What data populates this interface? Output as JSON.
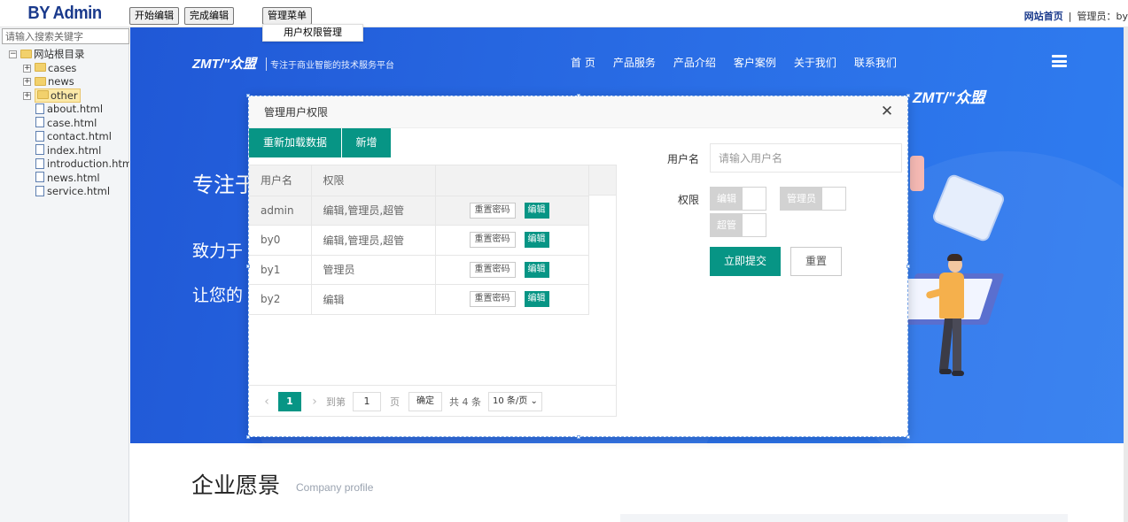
{
  "admin": {
    "brand": "BY Admin",
    "btn_start_edit": "开始编辑",
    "btn_finish_edit": "完成编辑",
    "btn_manage_menu": "管理菜单",
    "menu_item_permissions": "用户权限管理",
    "link_home": "网站首页",
    "separator": "|",
    "admin_label": "管理员：by"
  },
  "sidebar": {
    "search_placeholder": "请输入搜索关键字",
    "root": "网站根目录",
    "folders": [
      "cases",
      "news",
      "other"
    ],
    "files": [
      "about.html",
      "case.html",
      "contact.html",
      "index.html",
      "introduction.html",
      "news.html",
      "service.html"
    ]
  },
  "site": {
    "logo": "ZMT/\"众盟",
    "logo_sub": "专注于商业智能的技术服务平台",
    "nav": [
      "首 页",
      "产品服务",
      "产品介绍",
      "客户案例",
      "关于我们",
      "联系我们"
    ],
    "logo2": "ZMT/\"众盟",
    "hero_line1": "专注于",
    "hero_line2": "致力于",
    "hero_line3": "让您的",
    "section_title": "企业愿景",
    "section_sub": "Company profile"
  },
  "modal": {
    "title": "管理用户权限",
    "btn_reload": "重新加载数据",
    "btn_add": "新增",
    "columns": [
      "用户名",
      "权限"
    ],
    "rows": [
      {
        "user": "admin",
        "perm": "编辑,管理员,超管"
      },
      {
        "user": "by0",
        "perm": "编辑,管理员,超管"
      },
      {
        "user": "by1",
        "perm": "管理员"
      },
      {
        "user": "by2",
        "perm": "编辑"
      }
    ],
    "row_btn_reset": "重置密码",
    "row_btn_edit": "编辑",
    "pager": {
      "current": "1",
      "goto_prefix": "到第",
      "goto_value": "1",
      "goto_suffix": "页",
      "confirm": "确定",
      "total": "共 4 条",
      "page_size": "10 条/页 ⌄"
    },
    "form": {
      "username_label": "用户名",
      "username_placeholder": "请输入用户名",
      "perm_label": "权限",
      "perm_options": [
        "编辑",
        "管理员",
        "超管"
      ],
      "submit": "立即提交",
      "reset": "重置"
    }
  }
}
